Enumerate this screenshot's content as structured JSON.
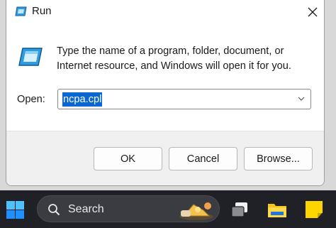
{
  "dialog": {
    "title": "Run",
    "description": "Type the name of a program, folder, document, or Internet resource, and Windows will open it for you.",
    "open_label": "Open:",
    "open_value": "ncpa.cpl",
    "ok_label": "OK",
    "cancel_label": "Cancel",
    "browse_label": "Browse..."
  },
  "taskbar": {
    "search_label": "Search"
  },
  "icons": {
    "title": "run-icon",
    "close": "close-icon",
    "main": "run-icon",
    "dropdown": "chevron-down-icon",
    "start": "windows-start-icon",
    "search": "search-icon",
    "widget": "widget-icon",
    "taskview": "task-view-icon",
    "explorer": "file-explorer-icon",
    "notes": "sticky-notes-icon"
  },
  "colors": {
    "selection": "#0a66d1",
    "taskbar": "#1f2127",
    "accent": "#1e90ff"
  }
}
